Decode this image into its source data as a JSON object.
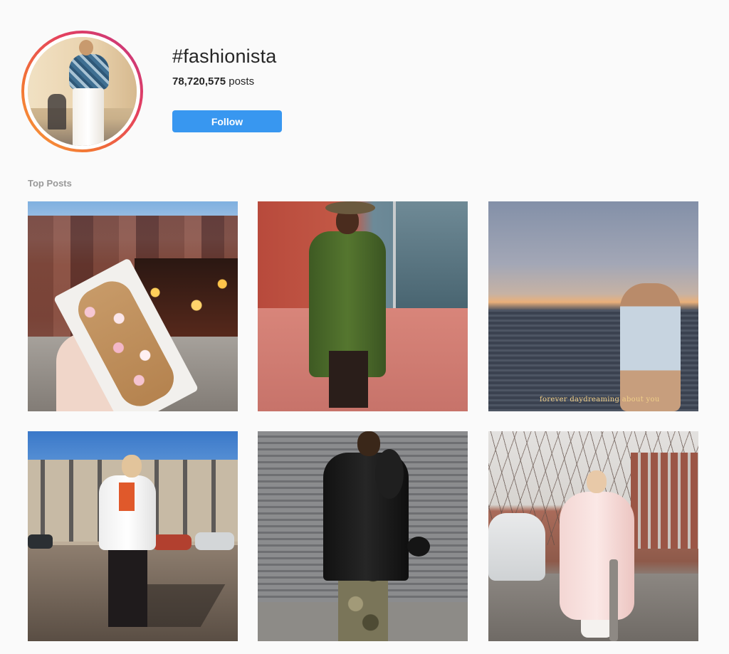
{
  "header": {
    "hashtag": "#fashionista",
    "post_count": "78,720,575",
    "post_count_suffix": "posts",
    "follow_label": "Follow"
  },
  "section": {
    "label": "Top Posts"
  },
  "posts": [
    {
      "subject": "street-treat",
      "caption": ""
    },
    {
      "subject": "green-coat",
      "caption": ""
    },
    {
      "subject": "sunset-sea",
      "caption": "forever daydreaming about you"
    },
    {
      "subject": "white-blazer",
      "caption": ""
    },
    {
      "subject": "camo-pants",
      "caption": ""
    },
    {
      "subject": "pink-fur-coat",
      "caption": ""
    }
  ],
  "colors": {
    "follow_button": "#3897f0",
    "ring_gradient": [
      "#f9a13a",
      "#e4405f",
      "#c13584"
    ],
    "background": "#fafafa",
    "muted_label": "#999999"
  }
}
